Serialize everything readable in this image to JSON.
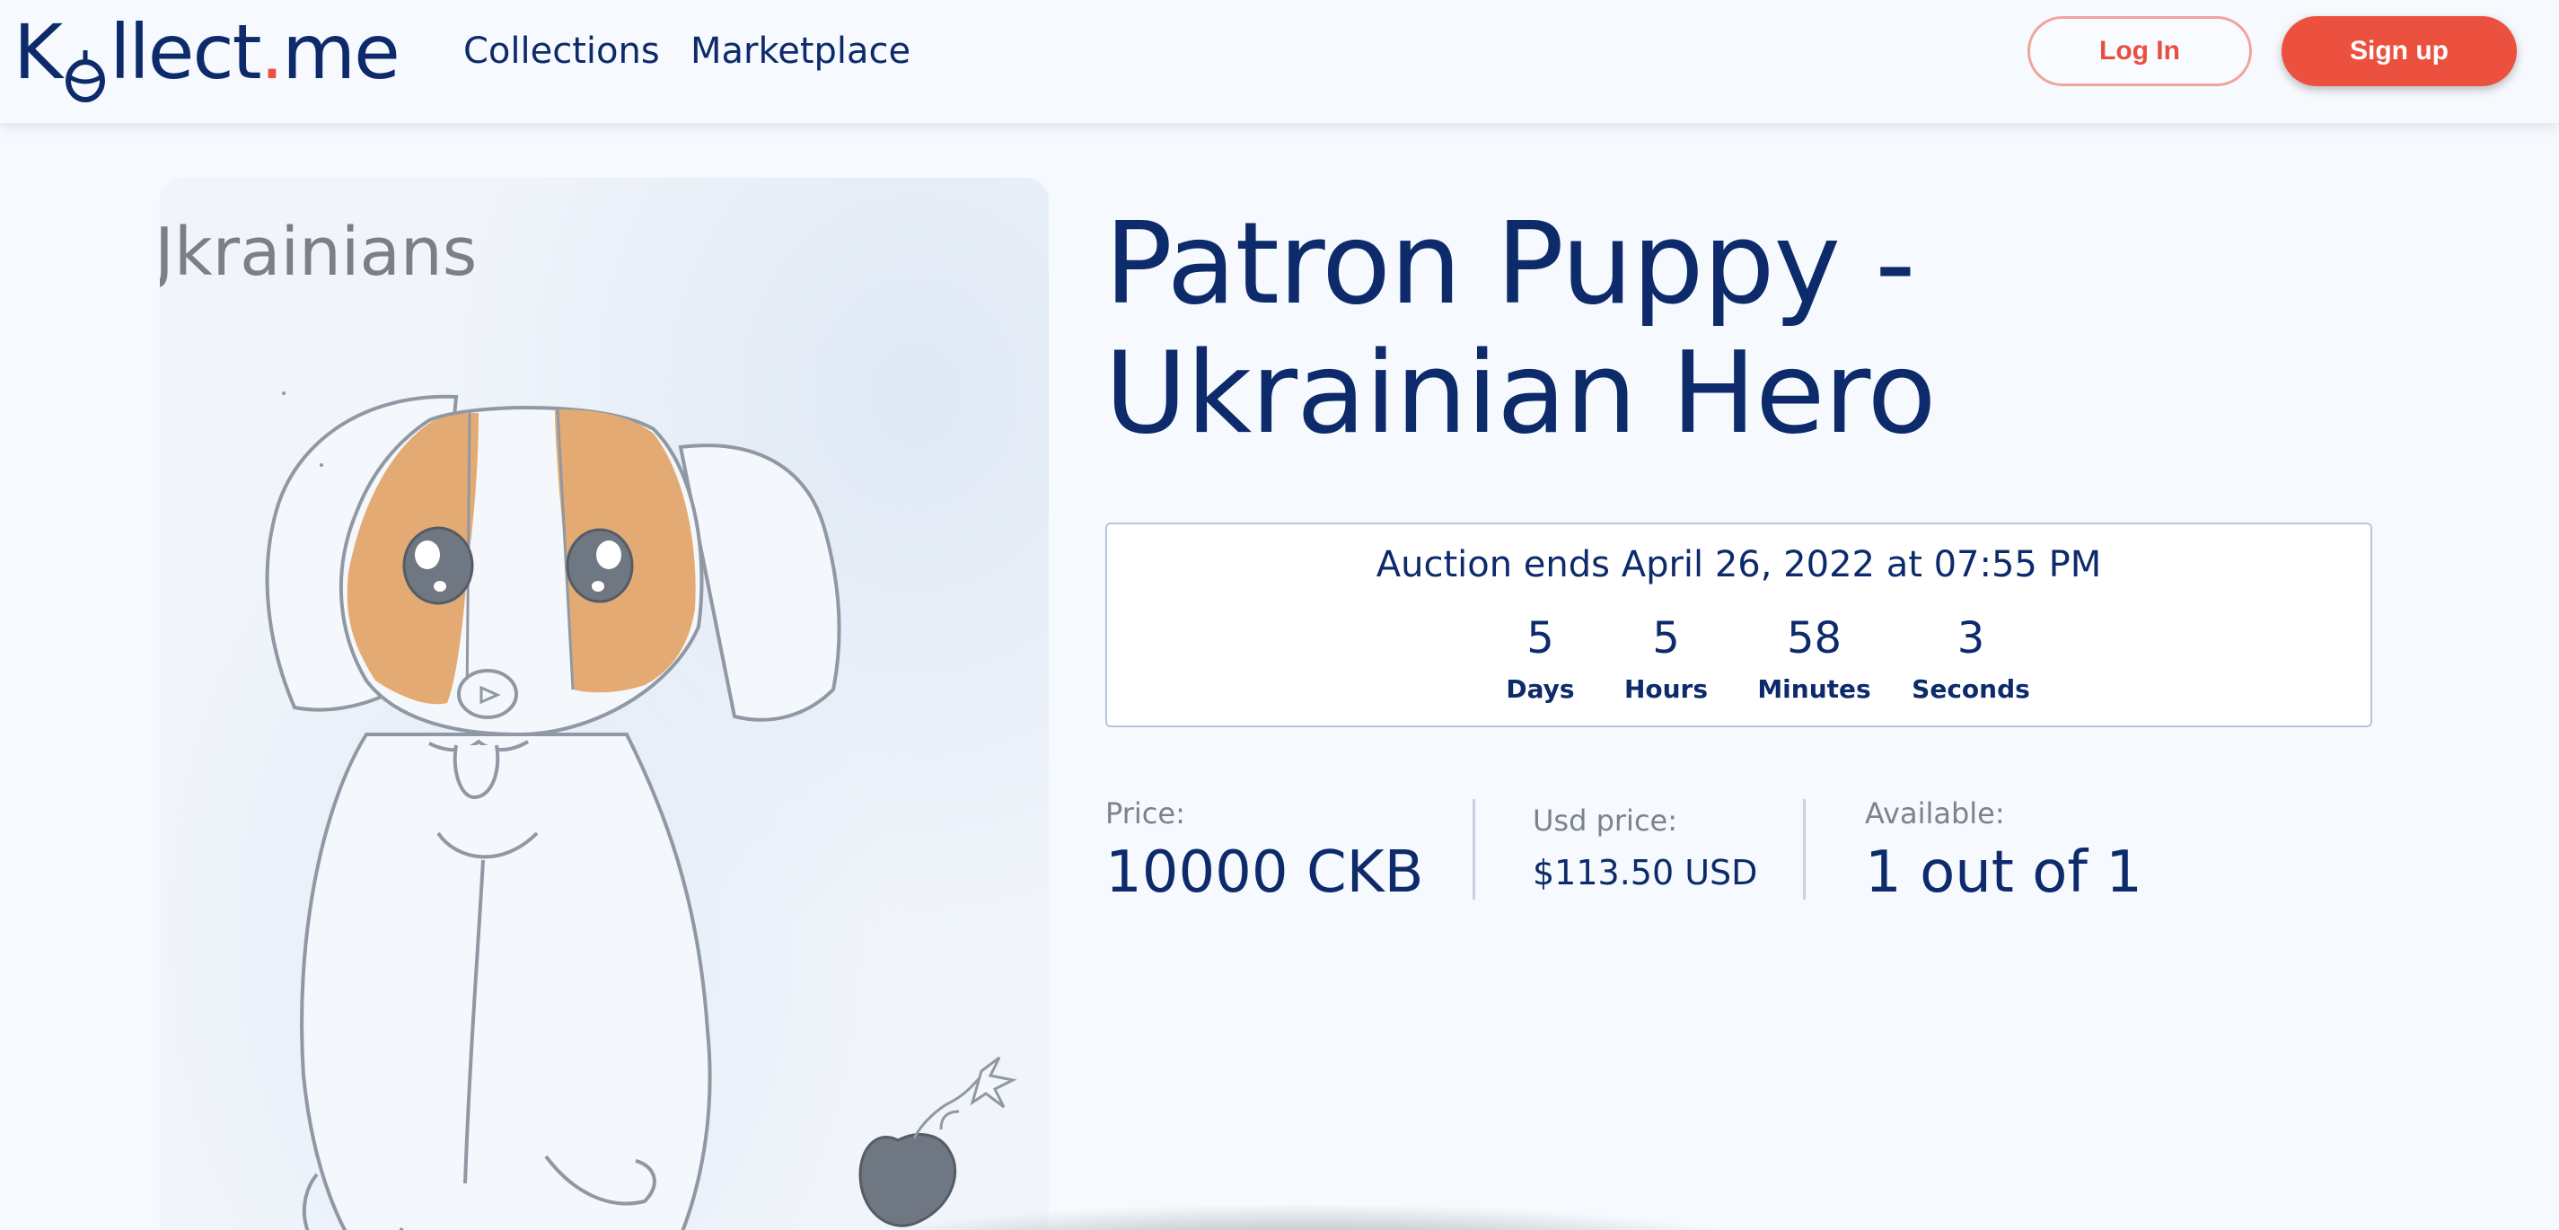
{
  "header": {
    "logo": {
      "prefix": "K",
      "suffix": "llect",
      "dot": ".",
      "tld": "me"
    },
    "nav": {
      "collections": "Collections",
      "marketplace": "Marketplace"
    },
    "login_label": "Log In",
    "signup_label": "Sign up"
  },
  "artwork": {
    "caption": "Jkrainians"
  },
  "item": {
    "title_line1": "Patron Puppy -",
    "title_line2": "Ukrainian Hero"
  },
  "auction": {
    "ends_text": "Auction ends April 26, 2022 at 07:55 PM",
    "countdown": [
      {
        "value": "5",
        "label": "Days"
      },
      {
        "value": "5",
        "label": "Hours"
      },
      {
        "value": "58",
        "label": "Minutes"
      },
      {
        "value": "3",
        "label": "Seconds"
      }
    ]
  },
  "stats": {
    "price_label": "Price:",
    "price_value": "10000 CKB",
    "usd_label": "Usd price:",
    "usd_value": "$113.50 USD",
    "available_label": "Available:",
    "available_value": "1 out of 1"
  },
  "colors": {
    "brand_navy": "#0d2a6b",
    "accent_red": "#ec503f",
    "background": "#f6f9fd"
  }
}
